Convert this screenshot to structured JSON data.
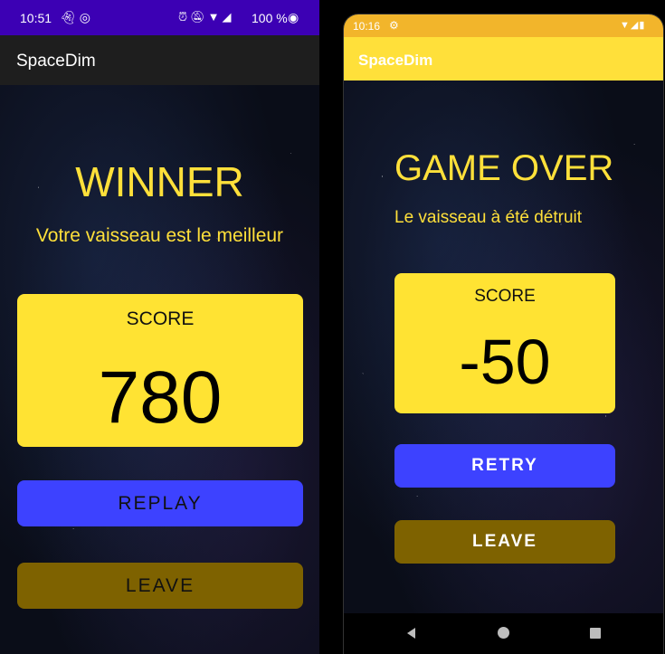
{
  "left_screen": {
    "status_bar": {
      "time": "10:51",
      "notification_icons": [
        "ghost-icon",
        "vpn-icon"
      ],
      "system_icons": [
        "alarm-icon",
        "mute-icon",
        "wifi-icon",
        "signal-icon"
      ],
      "battery": "100 %",
      "battery_icon": "battery-icon"
    },
    "app_bar": {
      "title": "SpaceDim"
    },
    "headline": "WINNER",
    "subline": "Votre vaisseau est le meilleur",
    "score": {
      "label": "SCORE",
      "value": "780"
    },
    "buttons": {
      "replay": "REPLAY",
      "leave": "LEAVE"
    },
    "colors": {
      "status_bar": "#3c00b4",
      "accent_yellow": "#ffe333",
      "replay": "#3d42ff",
      "leave": "#7e6200"
    }
  },
  "right_screen": {
    "status_bar": {
      "time": "10:16",
      "notification_icons": [
        "gear-icon"
      ],
      "system_icons": [
        "wifi-icon",
        "signal-icon",
        "battery-icon"
      ]
    },
    "app_bar": {
      "title": "SpaceDim"
    },
    "headline": "GAME OVER",
    "subline": "Le vaisseau à été détruit",
    "score": {
      "label": "SCORE",
      "value": "-50"
    },
    "buttons": {
      "retry": "RETRY",
      "leave": "LEAVE"
    },
    "nav_bar": {
      "icons": [
        "back-icon",
        "home-icon",
        "recent-apps-icon"
      ]
    },
    "colors": {
      "status_bar": "#f2b52b",
      "app_bar": "#ffe03a",
      "retry": "#3d42ff",
      "leave": "#7e6200"
    }
  }
}
